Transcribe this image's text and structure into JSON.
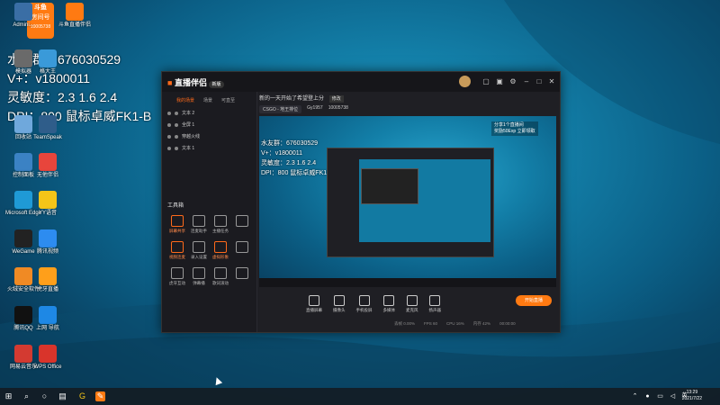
{
  "overlay": {
    "line1": "水友群：676030529",
    "line2": "V+：v1800011",
    "line3": "灵敏度：2.3   1.6  2.4",
    "line4": "DPI：800  鼠标卓威FK1-B",
    "badge_top": "斗鱼",
    "badge_room": "房间号",
    "badge_id": "10005738"
  },
  "desktop_icons": [
    {
      "label": "Admini...",
      "icon": "user-folder-icon",
      "color": "#3a6ea5"
    },
    {
      "label": "斗鱼直播伴侣",
      "icon": "douyu-icon",
      "color": "#ff7a12"
    },
    {
      "label": "模拟器",
      "icon": "emulator-icon",
      "color": "#6a6a6a"
    },
    {
      "label": "格大王",
      "icon": "app-icon",
      "color": "#3a9ad9"
    },
    {
      "label": "回收站",
      "icon": "recycle-bin-icon",
      "color": "#6fa8dc"
    },
    {
      "label": "TeamSpeak",
      "icon": "teamspeak-icon",
      "color": "#2f5d8a"
    },
    {
      "label": "控制面板",
      "icon": "control-panel-icon",
      "color": "#3b82c4"
    },
    {
      "label": "无他伴侣",
      "icon": "app-grid-icon",
      "color": "#e8453c"
    },
    {
      "label": "Microsoft Edge",
      "icon": "edge-icon",
      "color": "#1f9ad6"
    },
    {
      "label": "YY语音",
      "icon": "yy-icon",
      "color": "#f5c518"
    },
    {
      "label": "WeGame",
      "icon": "wegame-icon",
      "color": "#222222"
    },
    {
      "label": "腾讯视频",
      "icon": "video-icon",
      "color": "#2d8cf0"
    },
    {
      "label": "火绒安全软件",
      "icon": "shield-icon",
      "color": "#f08a24"
    },
    {
      "label": "虎牙直播",
      "icon": "huya-icon",
      "color": "#ff9f1a"
    },
    {
      "label": "腾讯QQ",
      "icon": "qq-icon",
      "color": "#111111"
    },
    {
      "label": "上网 导航",
      "icon": "ie-icon",
      "color": "#1e88e5"
    },
    {
      "label": "网易云音乐",
      "icon": "music-icon",
      "color": "#d33a31"
    },
    {
      "label": "WPS Office",
      "icon": "wps-icon",
      "color": "#d9342b"
    }
  ],
  "app": {
    "logo_text": "直播伴侣",
    "logo_badge": "新版",
    "left_tabs": [
      "我的场景",
      "场景",
      "可直至"
    ],
    "scenes": [
      "文本 2",
      "全屏 1",
      "穿越火线",
      "文本 1"
    ],
    "tools_title": "工具箱",
    "tools": [
      {
        "label": "屏幕共享",
        "icon": "share-icon",
        "accent": true
      },
      {
        "label": "连麦助手",
        "icon": "mic-link-icon",
        "accent": false
      },
      {
        "label": "主播任务",
        "icon": "task-icon",
        "accent": false
      },
      {
        "label": "",
        "icon": "more-icon",
        "accent": false
      },
      {
        "label": "视频连麦",
        "icon": "video-link-icon",
        "accent": true
      },
      {
        "label": "录入设置",
        "icon": "record-icon",
        "accent": false
      },
      {
        "label": "虚拟形象",
        "icon": "avatar-icon",
        "accent": true
      },
      {
        "label": "",
        "icon": "blank-icon",
        "accent": false
      },
      {
        "label": "虎牙互动",
        "icon": "interact-icon",
        "accent": false
      },
      {
        "label": "弹幕播",
        "icon": "danmu-icon",
        "accent": false
      },
      {
        "label": "歌词滚动",
        "icon": "lyrics-icon",
        "accent": false
      },
      {
        "label": "",
        "icon": "blank-icon",
        "accent": false
      }
    ],
    "stream_title": "新的一天开始了希望登上分",
    "edit_label": "修改",
    "chips": [
      "CSGO - 地王排位",
      "Gy1957",
      "10005738"
    ],
    "preview_overlay": [
      "水友群：676030529",
      "V+：v1800011",
      "灵敏度：2.3   1.6  2.4",
      "DPI：800  鼠标卓威FK1-B"
    ],
    "preview_corner": [
      "分享1个直播间",
      "奖励50Exp 立即领取"
    ],
    "controls": [
      {
        "label": "直播屏幕",
        "icon": "screen-icon"
      },
      {
        "label": "摄像头",
        "icon": "camera-icon"
      },
      {
        "label": "手机投屏",
        "icon": "phone-icon"
      },
      {
        "label": "多媒体",
        "icon": "media-icon"
      },
      {
        "label": "麦克风",
        "icon": "mic-icon"
      },
      {
        "label": "扬声器",
        "icon": "speaker-icon"
      }
    ],
    "live_button": "开始直播",
    "status": [
      "丢帧 0.00%",
      "FPS 60",
      "CPU 16%",
      "内存 42%",
      "00:00:00"
    ]
  },
  "taskbar": {
    "time": "13:29",
    "date": "2021/7/22",
    "lang": "英"
  }
}
